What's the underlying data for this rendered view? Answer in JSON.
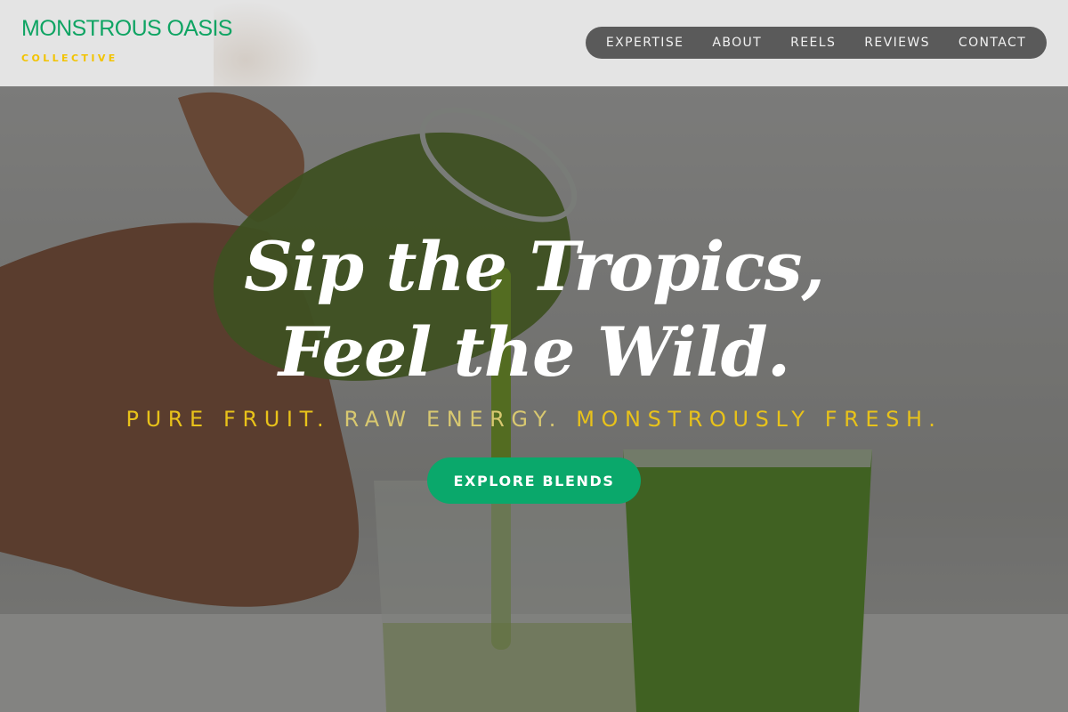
{
  "brand": {
    "name": "MONSTROUS OASIS",
    "tagline": "COLLECTIVE",
    "color": "#0fa463",
    "tagline_color": "#f2c300"
  },
  "nav": {
    "items": [
      {
        "label": "EXPERTISE"
      },
      {
        "label": "ABOUT"
      },
      {
        "label": "REELS"
      },
      {
        "label": "REVIEWS"
      },
      {
        "label": "CONTACT"
      }
    ]
  },
  "hero": {
    "headline_line1": "Sip the Tropics,",
    "headline_line2": "Feel the Wild.",
    "tagline_part1": "PURE FRUIT.",
    "tagline_part2": "RAW ENERGY.",
    "tagline_part3": "MONSTROUSLY FRESH.",
    "cta_label": "EXPLORE BLENDS",
    "cta_color": "#0aa86b",
    "image": "green-juice-pour-photo"
  }
}
